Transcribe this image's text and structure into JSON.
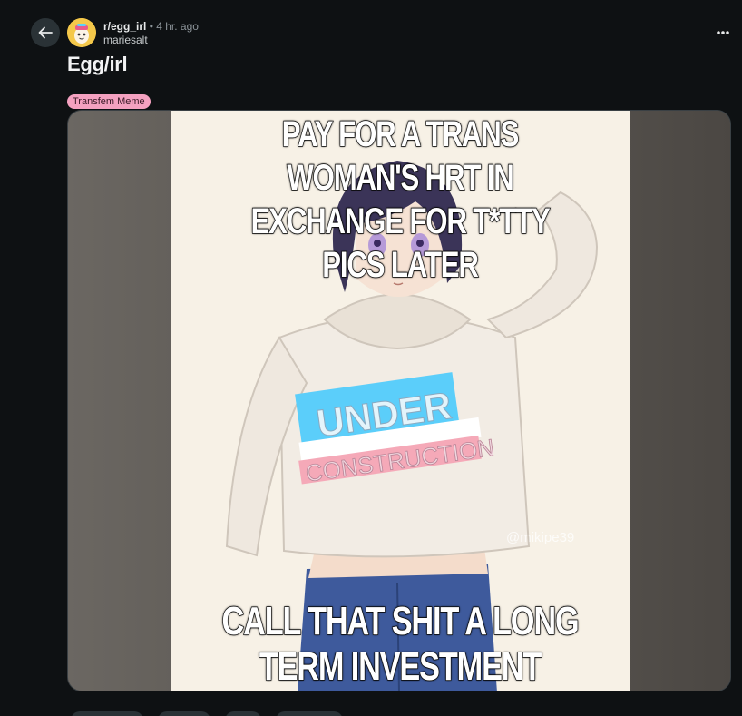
{
  "post": {
    "subreddit": "r/egg_irl",
    "separator": "•",
    "time": "4 hr. ago",
    "author": "mariesalt",
    "title": "Egg/irl",
    "flair": "Transfem Meme"
  },
  "meme": {
    "top_text": "PAY FOR A TRANS WOMAN'S HRT IN EXCHANGE FOR T*TTY PICS LATER",
    "bottom_text": "CALL THAT SHIT A LONG TERM INVESTMENT",
    "shirt_line1": "UNDER",
    "shirt_line2": "CONSTRUCTION",
    "watermark": "@mikipe39"
  },
  "icons": {
    "back": "arrow-left-icon",
    "more": "ellipsis-icon"
  },
  "colors": {
    "background": "#0e1113",
    "flair_bg": "#f4a1c0",
    "trans_blue": "#5bcefa",
    "trans_pink": "#f5a9b8"
  }
}
